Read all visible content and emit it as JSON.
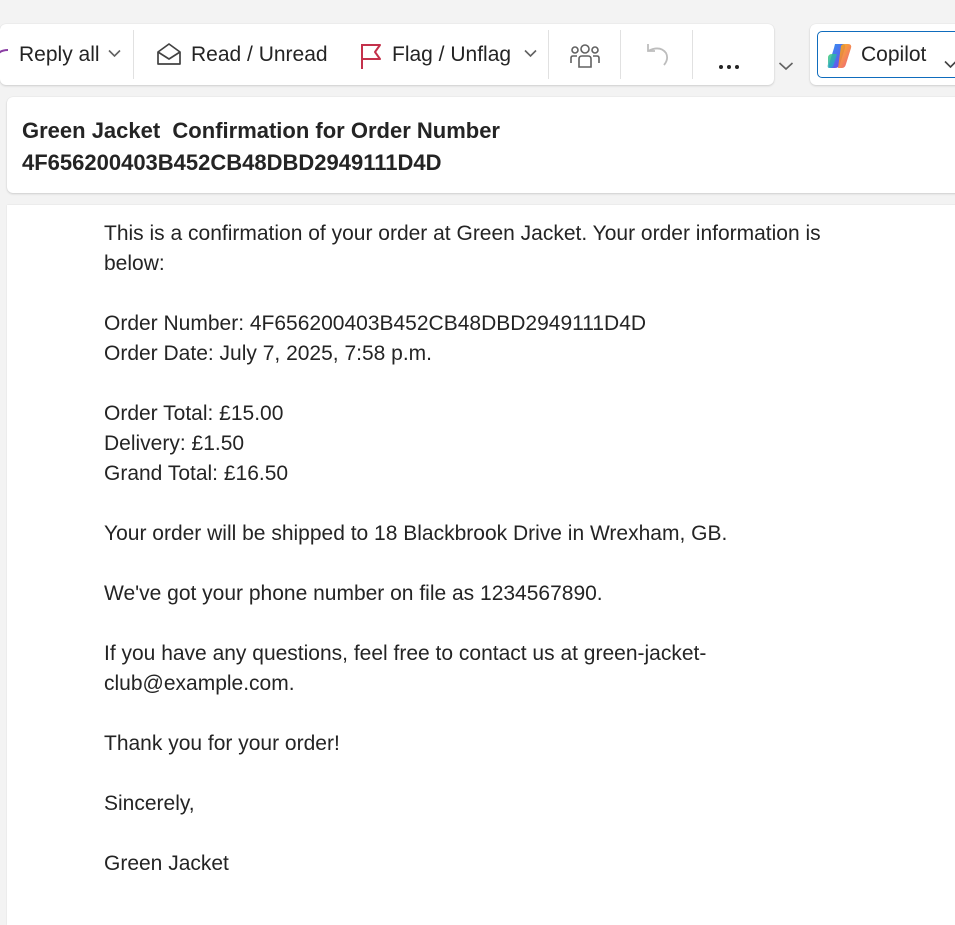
{
  "toolbar": {
    "reply_all_label": "Reply all",
    "read_unread_label": "Read / Unread",
    "flag_unflag_label": "Flag / Unflag"
  },
  "copilot": {
    "label": "Copilot"
  },
  "email": {
    "subject_line1": "Green Jacket  Confirmation for Order Number",
    "subject_line2": "4F656200403B452CB48DBD2949111D4D",
    "body": {
      "intro_line1": "This is a confirmation of your order at Green Jacket. Your order information is",
      "intro_line2": "below:",
      "order_number": "Order Number: 4F656200403B452CB48DBD2949111D4D",
      "order_date": "Order Date: July 7, 2025, 7:58 p.m.",
      "order_total": "Order Total: £15.00",
      "delivery": "Delivery: £1.50",
      "grand_total": "Grand Total: £16.50",
      "shipping": "Your order will be shipped to 18 Blackbrook Drive in Wrexham, GB.",
      "phone": "We've got your phone number on file as 1234567890.",
      "contact_line1": "If you have any questions, feel free to contact us at green-jacket-",
      "contact_line2": "club@example.com.",
      "thanks": "Thank you for your order!",
      "signoff": "Sincerely,",
      "signature": "Green Jacket"
    }
  },
  "colors": {
    "accent": "#0f6cbd",
    "flag_red": "#c4314b",
    "text": "#242424",
    "icon_gray": "#616161",
    "disabled_gray": "#bdbdbd"
  },
  "icons": [
    "reply-all-icon",
    "envelope-open-icon",
    "flag-icon",
    "people-group-icon",
    "undo-icon",
    "more-icon",
    "chevron-down-icon",
    "copilot-logo-icon"
  ]
}
